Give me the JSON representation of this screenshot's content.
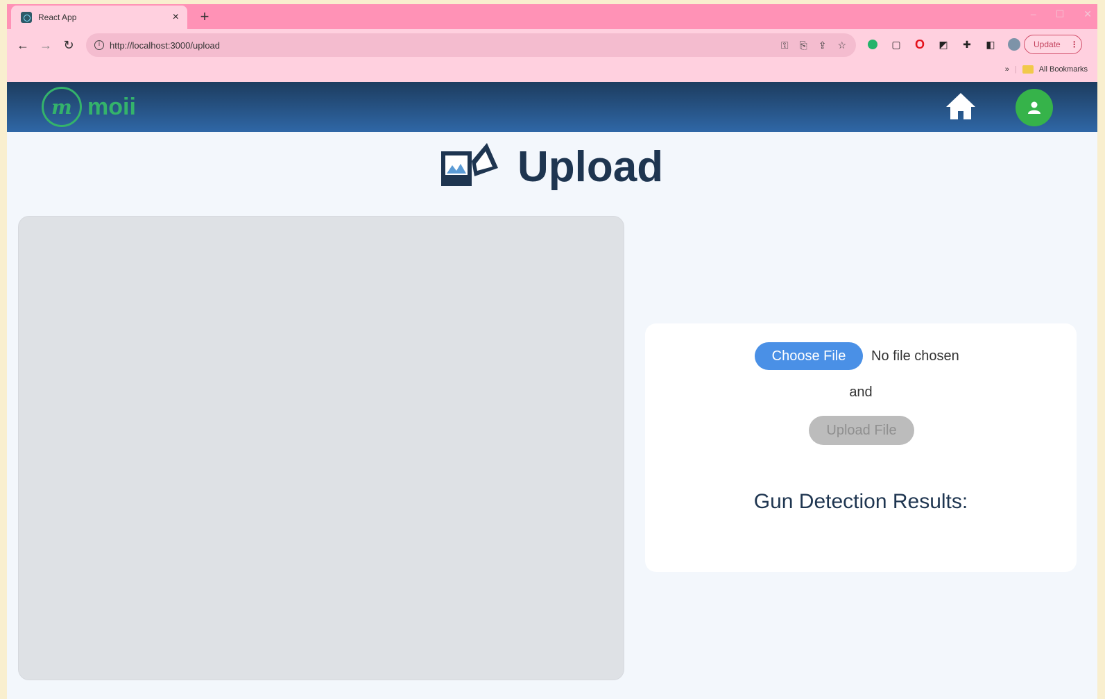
{
  "browser": {
    "tab_title": "React App",
    "tab_close": "×",
    "new_tab": "+",
    "window_controls": [
      "‒",
      "☐",
      "✕"
    ],
    "url": "http://localhost:3000/upload",
    "update_label": "Update",
    "bookmarks_label": "All Bookmarks",
    "extensions": [
      "green-circle-icon",
      "page-icon",
      "opera-icon",
      "square-icon",
      "puzzle-icon",
      "sidepanel-icon",
      "avatar-icon"
    ]
  },
  "app": {
    "logo_mark": "m",
    "logo_text": "moii",
    "header_colors": [
      "#1d3c5f",
      "#2f67a6"
    ],
    "accent_green": "#34b36b"
  },
  "page": {
    "title": "Upload"
  },
  "upload_card": {
    "choose_label": "Choose File",
    "no_file_text": "No file chosen",
    "and_text": "and",
    "upload_label": "Upload File",
    "results_title": "Gun Detection Results:"
  }
}
